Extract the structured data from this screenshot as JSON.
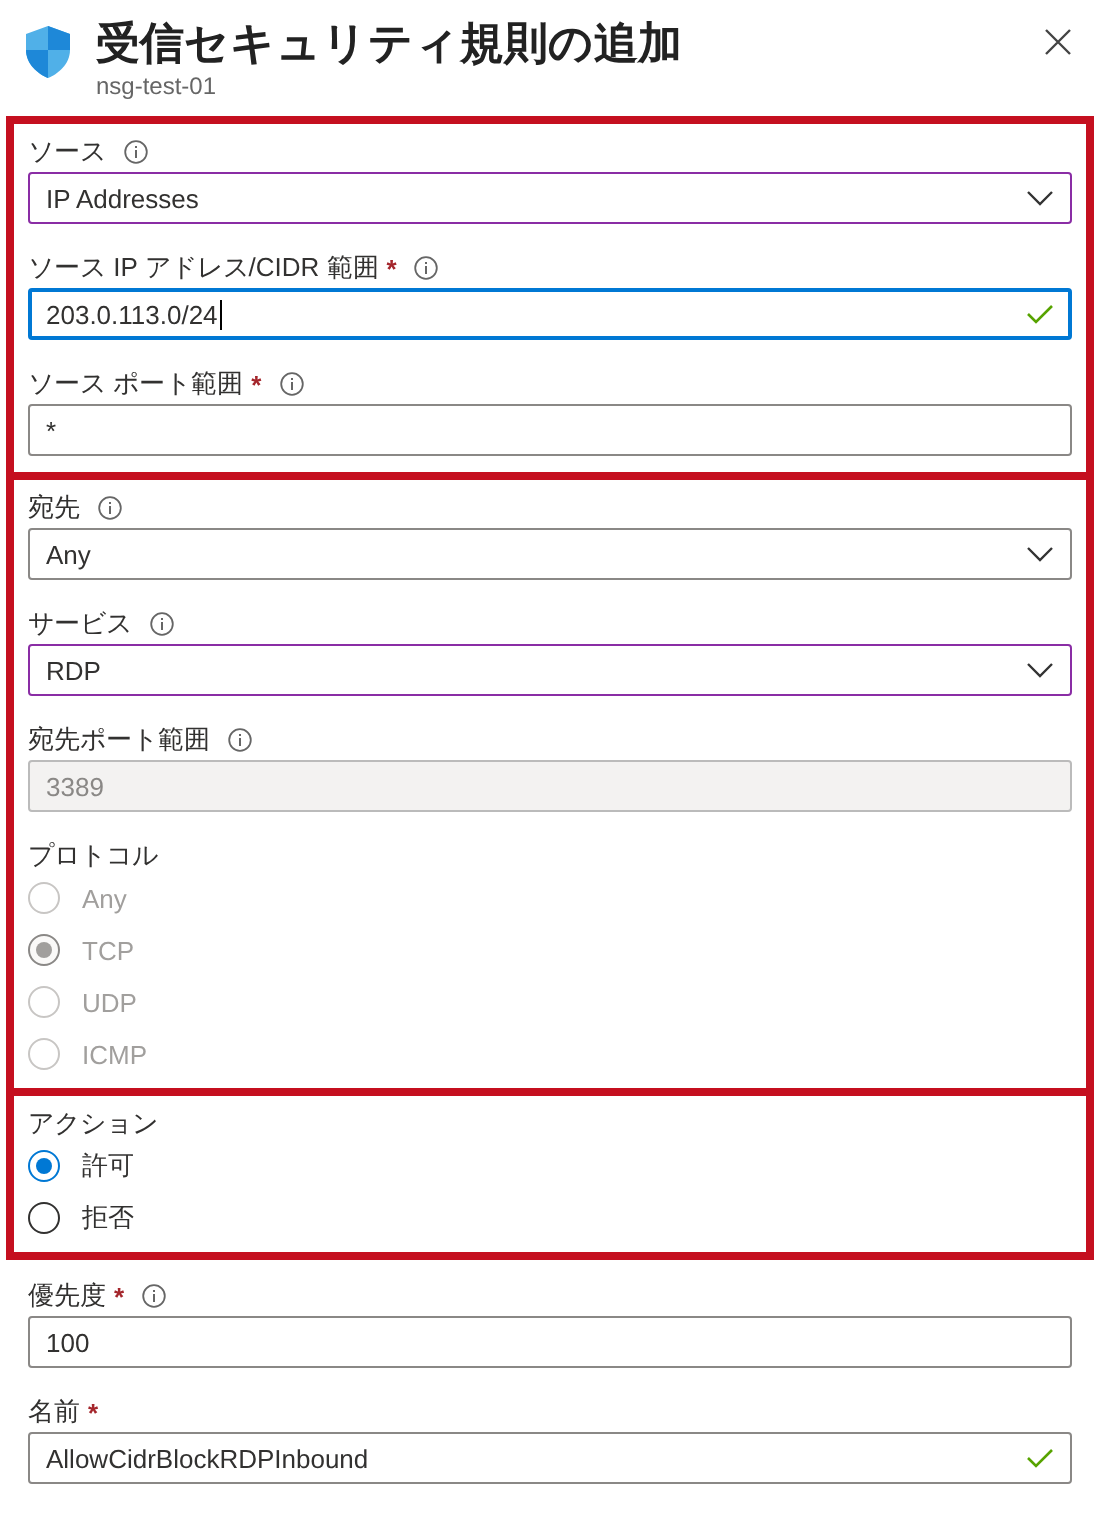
{
  "header": {
    "title": "受信セキュリティ規則の追加",
    "subtitle": "nsg-test-01"
  },
  "sections": [
    {
      "highlighted": true,
      "fields": [
        {
          "kind": "dropdown",
          "label": "ソース",
          "info": true,
          "value": "IP Addresses",
          "modified": true,
          "focused": false
        },
        {
          "kind": "text",
          "label": "ソース IP アドレス/CIDR 範囲",
          "required_mark": "*",
          "info": true,
          "value": "203.0.113.0/24",
          "focused": true,
          "disabled": false,
          "valid": true
        },
        {
          "kind": "text",
          "label": "ソース ポート範囲",
          "required_mark": "*",
          "info": true,
          "value": "*",
          "focused": false,
          "disabled": false,
          "valid": false
        }
      ]
    },
    {
      "highlighted": true,
      "fields": [
        {
          "kind": "dropdown",
          "label": "宛先",
          "info": true,
          "value": "Any",
          "modified": false,
          "focused": false
        },
        {
          "kind": "dropdown",
          "label": "サービス",
          "info": true,
          "value": "RDP",
          "modified": true,
          "focused": false
        },
        {
          "kind": "text",
          "label": "宛先ポート範囲",
          "info": true,
          "value": "3389",
          "focused": false,
          "disabled": true,
          "valid": false
        },
        {
          "kind": "radio",
          "label": "プロトコル",
          "disabled": true,
          "options": [
            {
              "label": "Any",
              "selected": false
            },
            {
              "label": "TCP",
              "selected": true
            },
            {
              "label": "UDP",
              "selected": false
            },
            {
              "label": "ICMP",
              "selected": false
            }
          ]
        }
      ]
    },
    {
      "highlighted": true,
      "fields": [
        {
          "kind": "radio",
          "label": "アクション",
          "disabled": false,
          "options": [
            {
              "label": "許可",
              "selected": true
            },
            {
              "label": "拒否",
              "selected": false
            }
          ]
        }
      ]
    },
    {
      "highlighted": false,
      "fields": [
        {
          "kind": "text",
          "label": "優先度",
          "required_mark": "*",
          "info": true,
          "value": "100",
          "focused": false,
          "disabled": false,
          "valid": false
        },
        {
          "kind": "text",
          "label": "名前",
          "required_mark": "*",
          "info": false,
          "value": "AllowCidrBlockRDPInbound",
          "focused": false,
          "disabled": false,
          "valid": true
        }
      ]
    }
  ]
}
